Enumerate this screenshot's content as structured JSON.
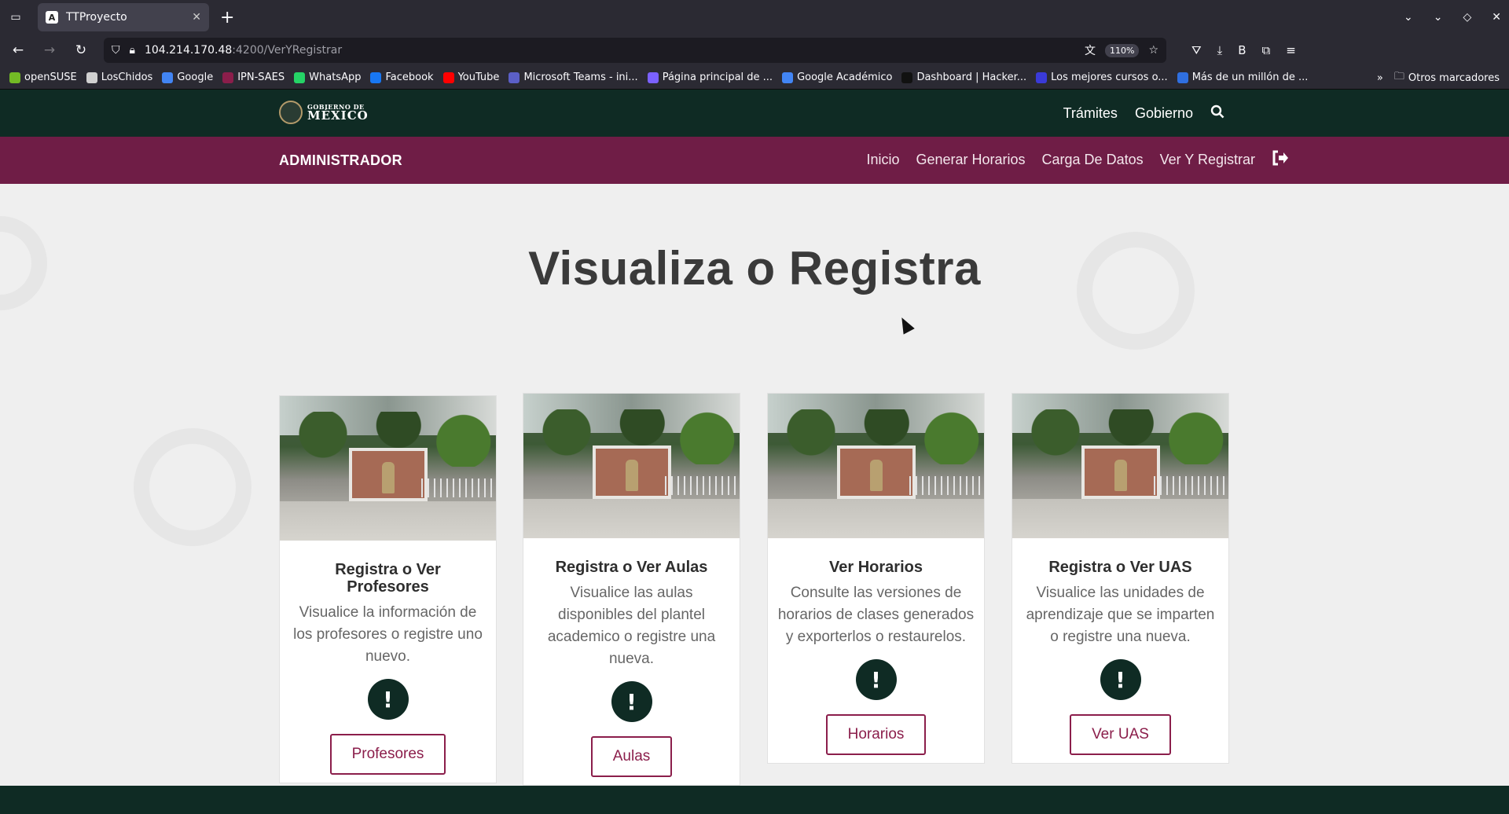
{
  "browser": {
    "tab_title": "TTProyecto",
    "tab_favicon": "A",
    "url_host": "104.214.170.48",
    "url_rest": ":4200/VerYRegistrar",
    "zoom": "110%",
    "profile_initial": "B"
  },
  "bookmarks": [
    {
      "label": "openSUSE",
      "color": "#73ba25"
    },
    {
      "label": "LosChidos",
      "color": "#d0d0d0"
    },
    {
      "label": "Google",
      "color": "#4285f4"
    },
    {
      "label": "IPN-SAES",
      "color": "#8b1e4b"
    },
    {
      "label": "WhatsApp",
      "color": "#25d366"
    },
    {
      "label": "Facebook",
      "color": "#1877f2"
    },
    {
      "label": "YouTube",
      "color": "#ff0000"
    },
    {
      "label": "Microsoft Teams - ini...",
      "color": "#5b5fc7"
    },
    {
      "label": "Página principal de ...",
      "color": "#7b61ff"
    },
    {
      "label": "Google Académico",
      "color": "#4285f4"
    },
    {
      "label": "Dashboard | Hacker...",
      "color": "#111111"
    },
    {
      "label": "Los mejores cursos o...",
      "color": "#3a3ad8"
    },
    {
      "label": "Más de un millón de ...",
      "color": "#2f6fe0"
    }
  ],
  "bookmarks_other": "Otros marcadores",
  "gob": {
    "logo_line1": "GOBIERNO DE",
    "logo_line2": "MÉXICO",
    "nav": [
      "Trámites",
      "Gobierno"
    ]
  },
  "admin": {
    "brand": "ADMINISTRADOR",
    "menu": [
      "Inicio",
      "Generar Horarios",
      "Carga De Datos",
      "Ver Y Registrar"
    ]
  },
  "page": {
    "title": "Visualiza o Registra"
  },
  "cards": [
    {
      "title": "Registra o Ver Profesores",
      "text": "Visualice la información de los profesores o registre uno nuevo.",
      "button": "Profesores"
    },
    {
      "title": "Registra o Ver Aulas",
      "text": "Visualice las aulas disponibles del plantel academico o registre una nueva.",
      "button": "Aulas"
    },
    {
      "title": "Ver Horarios",
      "text": "Consulte las versiones de horarios de clases generados y exporterlos o restaurelos.",
      "button": "Horarios"
    },
    {
      "title": "Registra o Ver UAS",
      "text": "Visualice las unidades de aprendizaje que se imparten o registre una nueva.",
      "button": "Ver UAS"
    }
  ],
  "colors": {
    "gob_green": "#0f2b24",
    "admin_maroon": "#6f1d46",
    "button_border": "#8b1e4b"
  }
}
